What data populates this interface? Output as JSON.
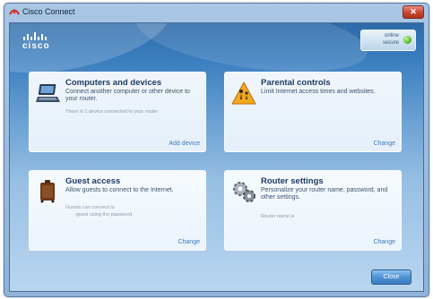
{
  "window": {
    "title": "Cisco Connect"
  },
  "header": {
    "logo_text": "cisco",
    "status": {
      "line1": "online",
      "line2": "secure",
      "color": "#5fbf2a"
    }
  },
  "tiles": [
    {
      "title": "Computers and devices",
      "description": "Connect another computer or other device to your router.",
      "note": "There is 1 device connected to your router",
      "link": "Add device"
    },
    {
      "title": "Parental controls",
      "description": "Limit Internet access times and websites.",
      "note": "",
      "link": "Change"
    },
    {
      "title": "Guest access",
      "description": "Allow guests to connect to the Internet.",
      "note_line1": "Guests can connect to",
      "note_line2": "-guest using the password",
      "link": "Change"
    },
    {
      "title": "Router settings",
      "description": "Personalize your router name, password, and other settings.",
      "note": "Router name is",
      "link": "Change"
    }
  ],
  "footer": {
    "close_label": "Close"
  },
  "icons": [
    "cisco-logo-icon",
    "computer-icon",
    "parental-controls-icon",
    "guest-access-icon",
    "router-settings-icon"
  ],
  "colors": {
    "accent": "#3d79bd",
    "titlebar_close": "#c8462f"
  }
}
